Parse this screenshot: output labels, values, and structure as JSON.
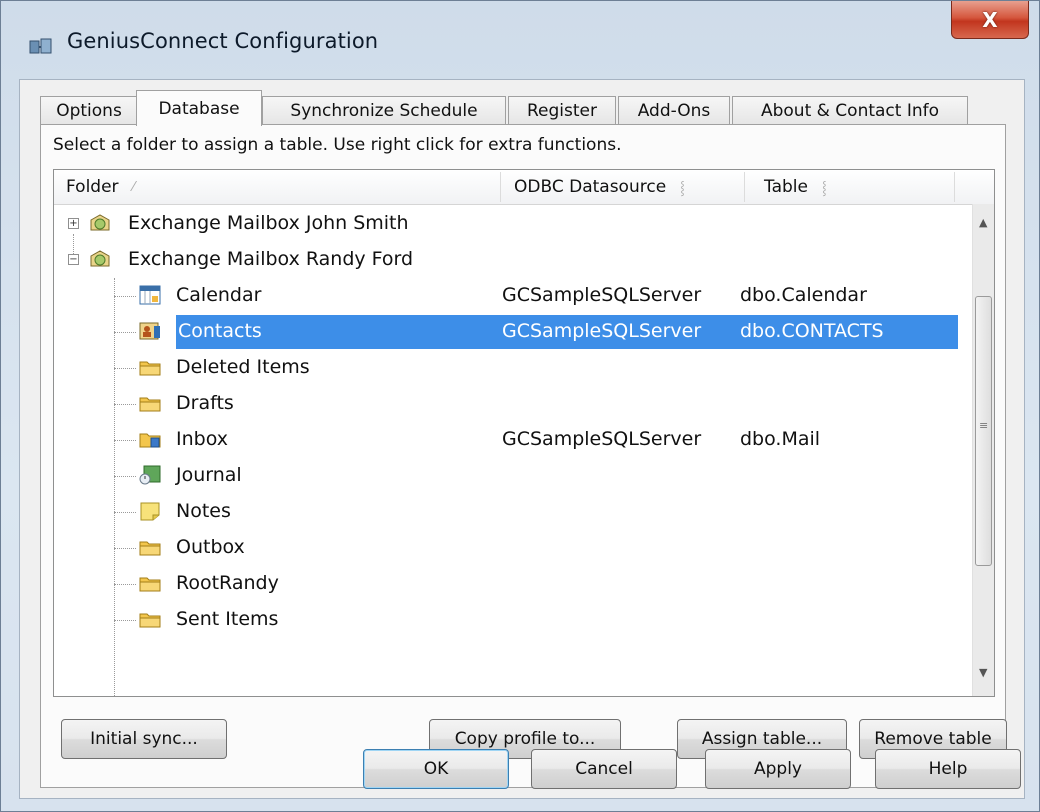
{
  "window": {
    "title": "GeniusConnect Configuration",
    "close_label": "X"
  },
  "tabs": [
    {
      "label": "Options",
      "active": false
    },
    {
      "label": "Database",
      "active": true
    },
    {
      "label": "Synchronize Schedule",
      "active": false
    },
    {
      "label": "Register",
      "active": false
    },
    {
      "label": "Add-Ons",
      "active": false
    },
    {
      "label": "About & Contact Info",
      "active": false
    }
  ],
  "instruction": "Select a folder to assign a table. Use right click for extra functions.",
  "columns": {
    "folder": "Folder",
    "datasource": "ODBC Datasource",
    "table": "Table"
  },
  "mailboxes": [
    {
      "label": "Exchange Mailbox John Smith",
      "expanded": false
    },
    {
      "label": "Exchange Mailbox Randy Ford",
      "expanded": true
    }
  ],
  "folders": [
    {
      "name": "Calendar",
      "datasource": "GCSampleSQLServer",
      "table": "dbo.Calendar",
      "icon": "calendar-icon"
    },
    {
      "name": "Contacts",
      "datasource": "GCSampleSQLServer",
      "table": "dbo.CONTACTS",
      "icon": "contacts-icon",
      "selected": true
    },
    {
      "name": "Deleted Items",
      "datasource": "",
      "table": "",
      "icon": "folder-icon"
    },
    {
      "name": "Drafts",
      "datasource": "",
      "table": "",
      "icon": "folder-icon"
    },
    {
      "name": "Inbox",
      "datasource": "GCSampleSQLServer",
      "table": "dbo.Mail",
      "icon": "inbox-icon"
    },
    {
      "name": "Journal",
      "datasource": "",
      "table": "",
      "icon": "journal-icon"
    },
    {
      "name": "Notes",
      "datasource": "",
      "table": "",
      "icon": "notes-icon"
    },
    {
      "name": "Outbox",
      "datasource": "",
      "table": "",
      "icon": "folder-icon"
    },
    {
      "name": "RootRandy",
      "datasource": "",
      "table": "",
      "icon": "folder-icon"
    },
    {
      "name": "Sent Items",
      "datasource": "",
      "table": "",
      "icon": "folder-icon"
    }
  ],
  "panel_buttons": {
    "initial_sync": "Initial sync...",
    "copy_profile": "Copy profile to...",
    "assign_table": "Assign table...",
    "remove_table": "Remove table"
  },
  "dialog_buttons": {
    "ok": "OK",
    "cancel": "Cancel",
    "apply": "Apply",
    "help": "Help"
  },
  "colors": {
    "selection": "#3d8ee8",
    "close_button": "#c94a33"
  }
}
